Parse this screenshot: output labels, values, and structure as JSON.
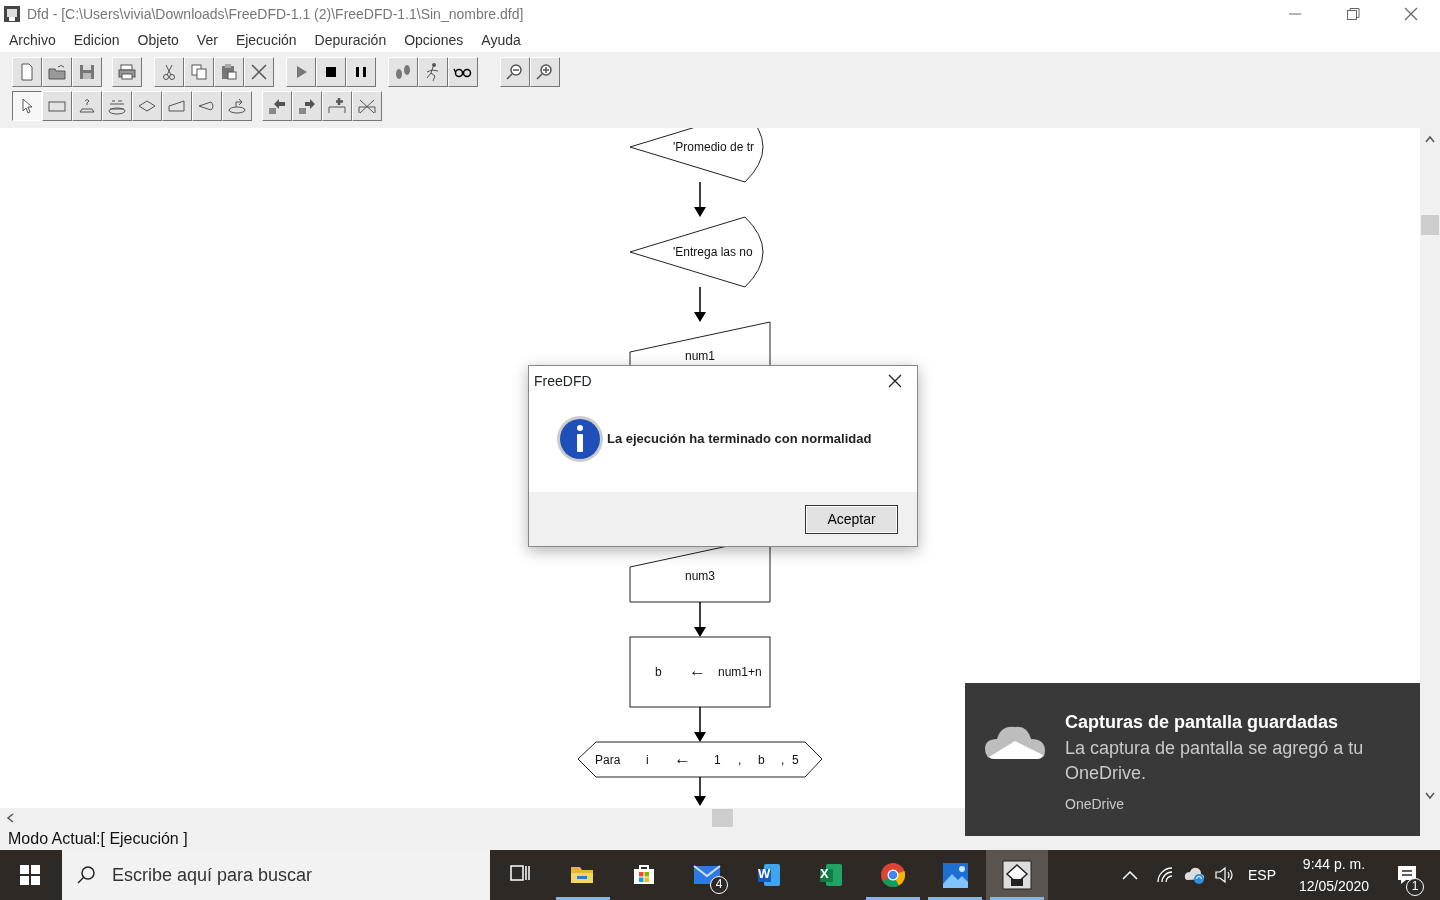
{
  "window": {
    "title": "Dfd - [C:\\Users\\vivia\\Downloads\\FreeDFD-1.1 (2)\\FreeDFD-1.1\\Sin_nombre.dfd]"
  },
  "menu": [
    "Archivo",
    "Edicion",
    "Objeto",
    "Ver",
    "Ejecución",
    "Depuración",
    "Opciones",
    "Ayuda"
  ],
  "toolbars": [
    [
      [
        {
          "kind": "new"
        },
        {
          "kind": "open"
        },
        {
          "kind": "save"
        }
      ],
      [
        {
          "kind": "print"
        }
      ],
      [
        {
          "kind": "cut"
        },
        {
          "kind": "copy"
        },
        {
          "kind": "paste"
        },
        {
          "kind": "delete"
        }
      ],
      [
        {
          "kind": "run"
        },
        {
          "kind": "stop"
        },
        {
          "kind": "pause"
        }
      ],
      [
        {
          "kind": "step"
        },
        {
          "kind": "runner"
        },
        {
          "kind": "glasses"
        }
      ],
      [
        {
          "kind": "zoom-out"
        },
        {
          "kind": "zoom-in"
        }
      ]
    ],
    [
      [
        {
          "kind": "pointer",
          "selected": true
        },
        {
          "kind": "process",
          "selected": false
        },
        {
          "kind": "read",
          "selected": false
        },
        {
          "kind": "loop",
          "selected": false
        },
        {
          "kind": "decision",
          "selected": false
        },
        {
          "kind": "output",
          "selected": false
        },
        {
          "kind": "display",
          "selected": false
        },
        {
          "kind": "call",
          "selected": false
        }
      ],
      [
        {
          "kind": "move-left",
          "selected": false
        },
        {
          "kind": "move-right",
          "selected": false
        },
        {
          "kind": "insert",
          "selected": false
        },
        {
          "kind": "remove",
          "selected": false
        }
      ]
    ]
  ],
  "flowchart": {
    "nodes": [
      {
        "kind": "display",
        "text": "'Promedio de tr"
      },
      {
        "kind": "display",
        "text": "'Entrega las no"
      },
      {
        "kind": "read",
        "text": "num1"
      },
      {
        "kind": "read",
        "text": "num3"
      },
      {
        "kind": "assign",
        "parts": [
          "b",
          "←",
          "num1+n"
        ]
      },
      {
        "kind": "loop",
        "parts": [
          "Para",
          "i",
          "←",
          "1",
          ",",
          "b",
          ",",
          "5"
        ]
      }
    ]
  },
  "status_bar": "Modo Actual:[ Ejecución ]",
  "dialog": {
    "title": "FreeDFD",
    "message": "La ejecución ha terminado con normalidad",
    "button": "Aceptar"
  },
  "toast": {
    "title": "Capturas de pantalla guardadas",
    "body": "La captura de pantalla se agregó a tu OneDrive.",
    "source": "OneDrive"
  },
  "taskbar": {
    "search_placeholder": "Escribe aquí para buscar",
    "apps": [
      {
        "kind": "task-view",
        "running": false,
        "active": false
      },
      {
        "kind": "explorer",
        "running": true,
        "active": false
      },
      {
        "kind": "store",
        "running": false,
        "active": false
      },
      {
        "kind": "mail",
        "running": false,
        "active": false,
        "badge": "4"
      },
      {
        "kind": "word",
        "running": false,
        "active": false,
        "glyph": "W"
      },
      {
        "kind": "excel",
        "running": false,
        "active": false,
        "glyph": "X"
      },
      {
        "kind": "chrome",
        "running": true,
        "active": false
      },
      {
        "kind": "photos",
        "running": true,
        "active": false
      },
      {
        "kind": "dfd",
        "running": true,
        "active": true
      }
    ],
    "language": "ESP",
    "time": "9:44 p. m.",
    "date": "12/05/2020",
    "notifications": "1"
  }
}
